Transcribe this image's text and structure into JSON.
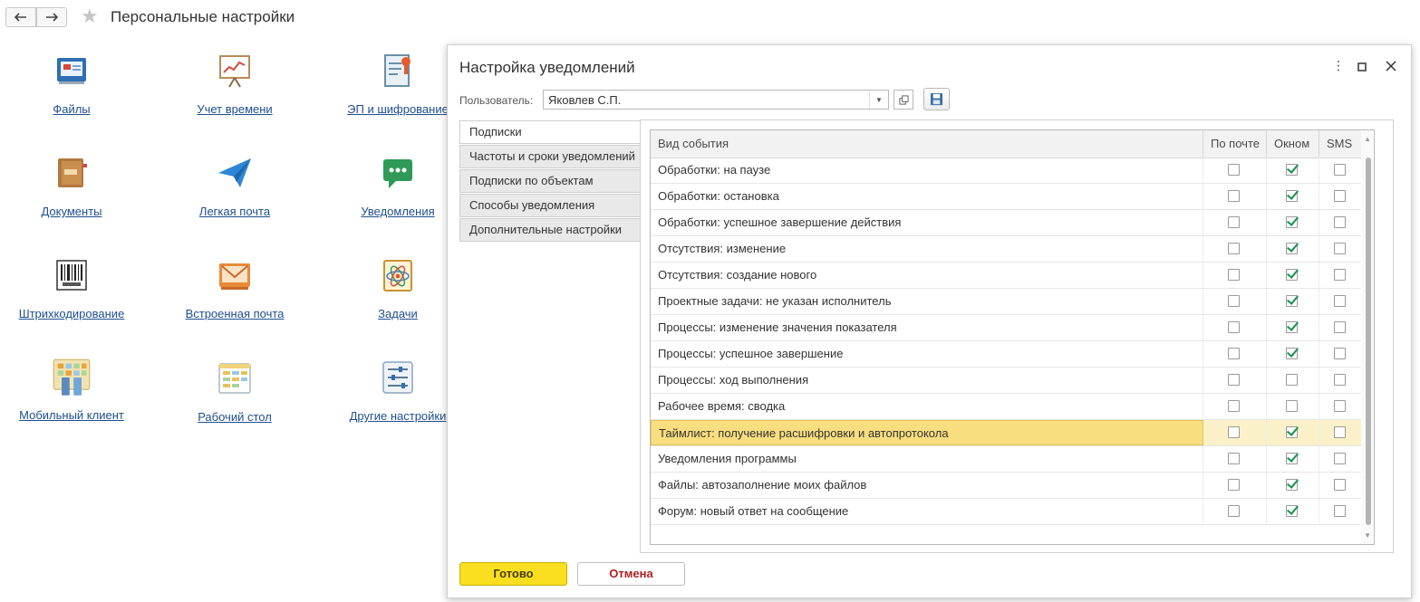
{
  "header": {
    "title": "Персональные настройки"
  },
  "tiles": [
    {
      "label": "Файлы",
      "icon": "files-icon"
    },
    {
      "label": "Учет времени",
      "icon": "time-tracking-icon"
    },
    {
      "label": "ЭП и шифрование",
      "icon": "certificate-icon"
    },
    {
      "label": "Документы",
      "icon": "documents-icon"
    },
    {
      "label": "Легкая почта",
      "icon": "paper-plane-icon"
    },
    {
      "label": "Уведомления",
      "icon": "chat-bubble-icon"
    },
    {
      "label": "Штрихкодирование",
      "icon": "barcode-icon"
    },
    {
      "label": "Встроенная почта",
      "icon": "envelope-icon"
    },
    {
      "label": "Задачи",
      "icon": "tasks-icon"
    },
    {
      "label": "Мобильный клиент",
      "icon": "mobile-client-icon"
    },
    {
      "label": "Рабочий стол",
      "icon": "desktop-icon"
    },
    {
      "label": "Другие настройки",
      "icon": "sliders-icon"
    }
  ],
  "dialog": {
    "title": "Настройка уведомлений",
    "user_label": "Пользователь:",
    "user_value": "Яковлев С.П.",
    "tabs": [
      "Подписки",
      "Частоты и сроки уведомлений",
      "Подписки по объектам",
      "Способы уведомления",
      "Дополнительные настройки"
    ],
    "table": {
      "headers": [
        "Вид события",
        "По почте",
        "Окном",
        "SMS"
      ],
      "rows": [
        {
          "event": "Обработки: на паузе",
          "email": false,
          "window": true,
          "sms": false
        },
        {
          "event": "Обработки: остановка",
          "email": false,
          "window": true,
          "sms": false
        },
        {
          "event": "Обработки: успешное завершение действия",
          "email": false,
          "window": true,
          "sms": false
        },
        {
          "event": "Отсутствия: изменение",
          "email": false,
          "window": true,
          "sms": false
        },
        {
          "event": "Отсутствия: создание нового",
          "email": false,
          "window": true,
          "sms": false
        },
        {
          "event": "Проектные задачи: не указан исполнитель",
          "email": false,
          "window": true,
          "sms": false
        },
        {
          "event": "Процессы: изменение значения показателя",
          "email": false,
          "window": true,
          "sms": false
        },
        {
          "event": "Процессы: успешное завершение",
          "email": false,
          "window": true,
          "sms": false
        },
        {
          "event": "Процессы: ход выполнения",
          "email": false,
          "window": false,
          "sms": false
        },
        {
          "event": "Рабочее время: сводка",
          "email": false,
          "window": false,
          "sms": false
        },
        {
          "event": "Таймлист: получение расшифровки и автопротокола",
          "email": false,
          "window": true,
          "sms": false,
          "selected": true
        },
        {
          "event": "Уведомления программы",
          "email": false,
          "window": true,
          "sms": false
        },
        {
          "event": "Файлы: автозаполнение моих файлов",
          "email": false,
          "window": true,
          "sms": false
        },
        {
          "event": "Форум: новый ответ на сообщение",
          "email": false,
          "window": true,
          "sms": false
        }
      ]
    },
    "ok_label": "Готово",
    "cancel_label": "Отмена"
  },
  "colors": {
    "link": "#1f4f8f",
    "ok_button": "#f9df1f",
    "cancel_text": "#b02020",
    "check": "#15934a",
    "selected_row": "#f8de7e"
  }
}
